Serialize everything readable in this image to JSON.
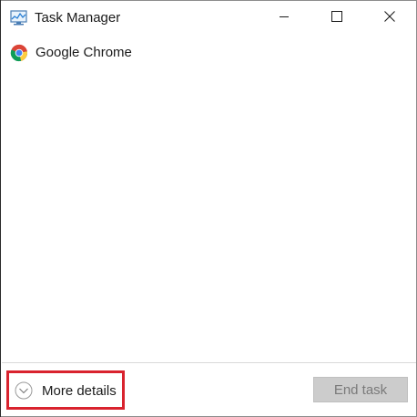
{
  "window": {
    "title": "Task Manager",
    "app_icon": "task-manager-icon",
    "controls": {
      "minimize_icon": "minimize-icon",
      "maximize_icon": "maximize-icon",
      "close_icon": "close-icon"
    }
  },
  "processes": [
    {
      "name": "Google Chrome",
      "icon": "chrome-icon"
    }
  ],
  "footer": {
    "more_details_label": "More details",
    "more_details_icon": "chevron-down-circle-icon",
    "end_task_label": "End task",
    "end_task_enabled": false,
    "highlight_color": "#d9232e"
  }
}
